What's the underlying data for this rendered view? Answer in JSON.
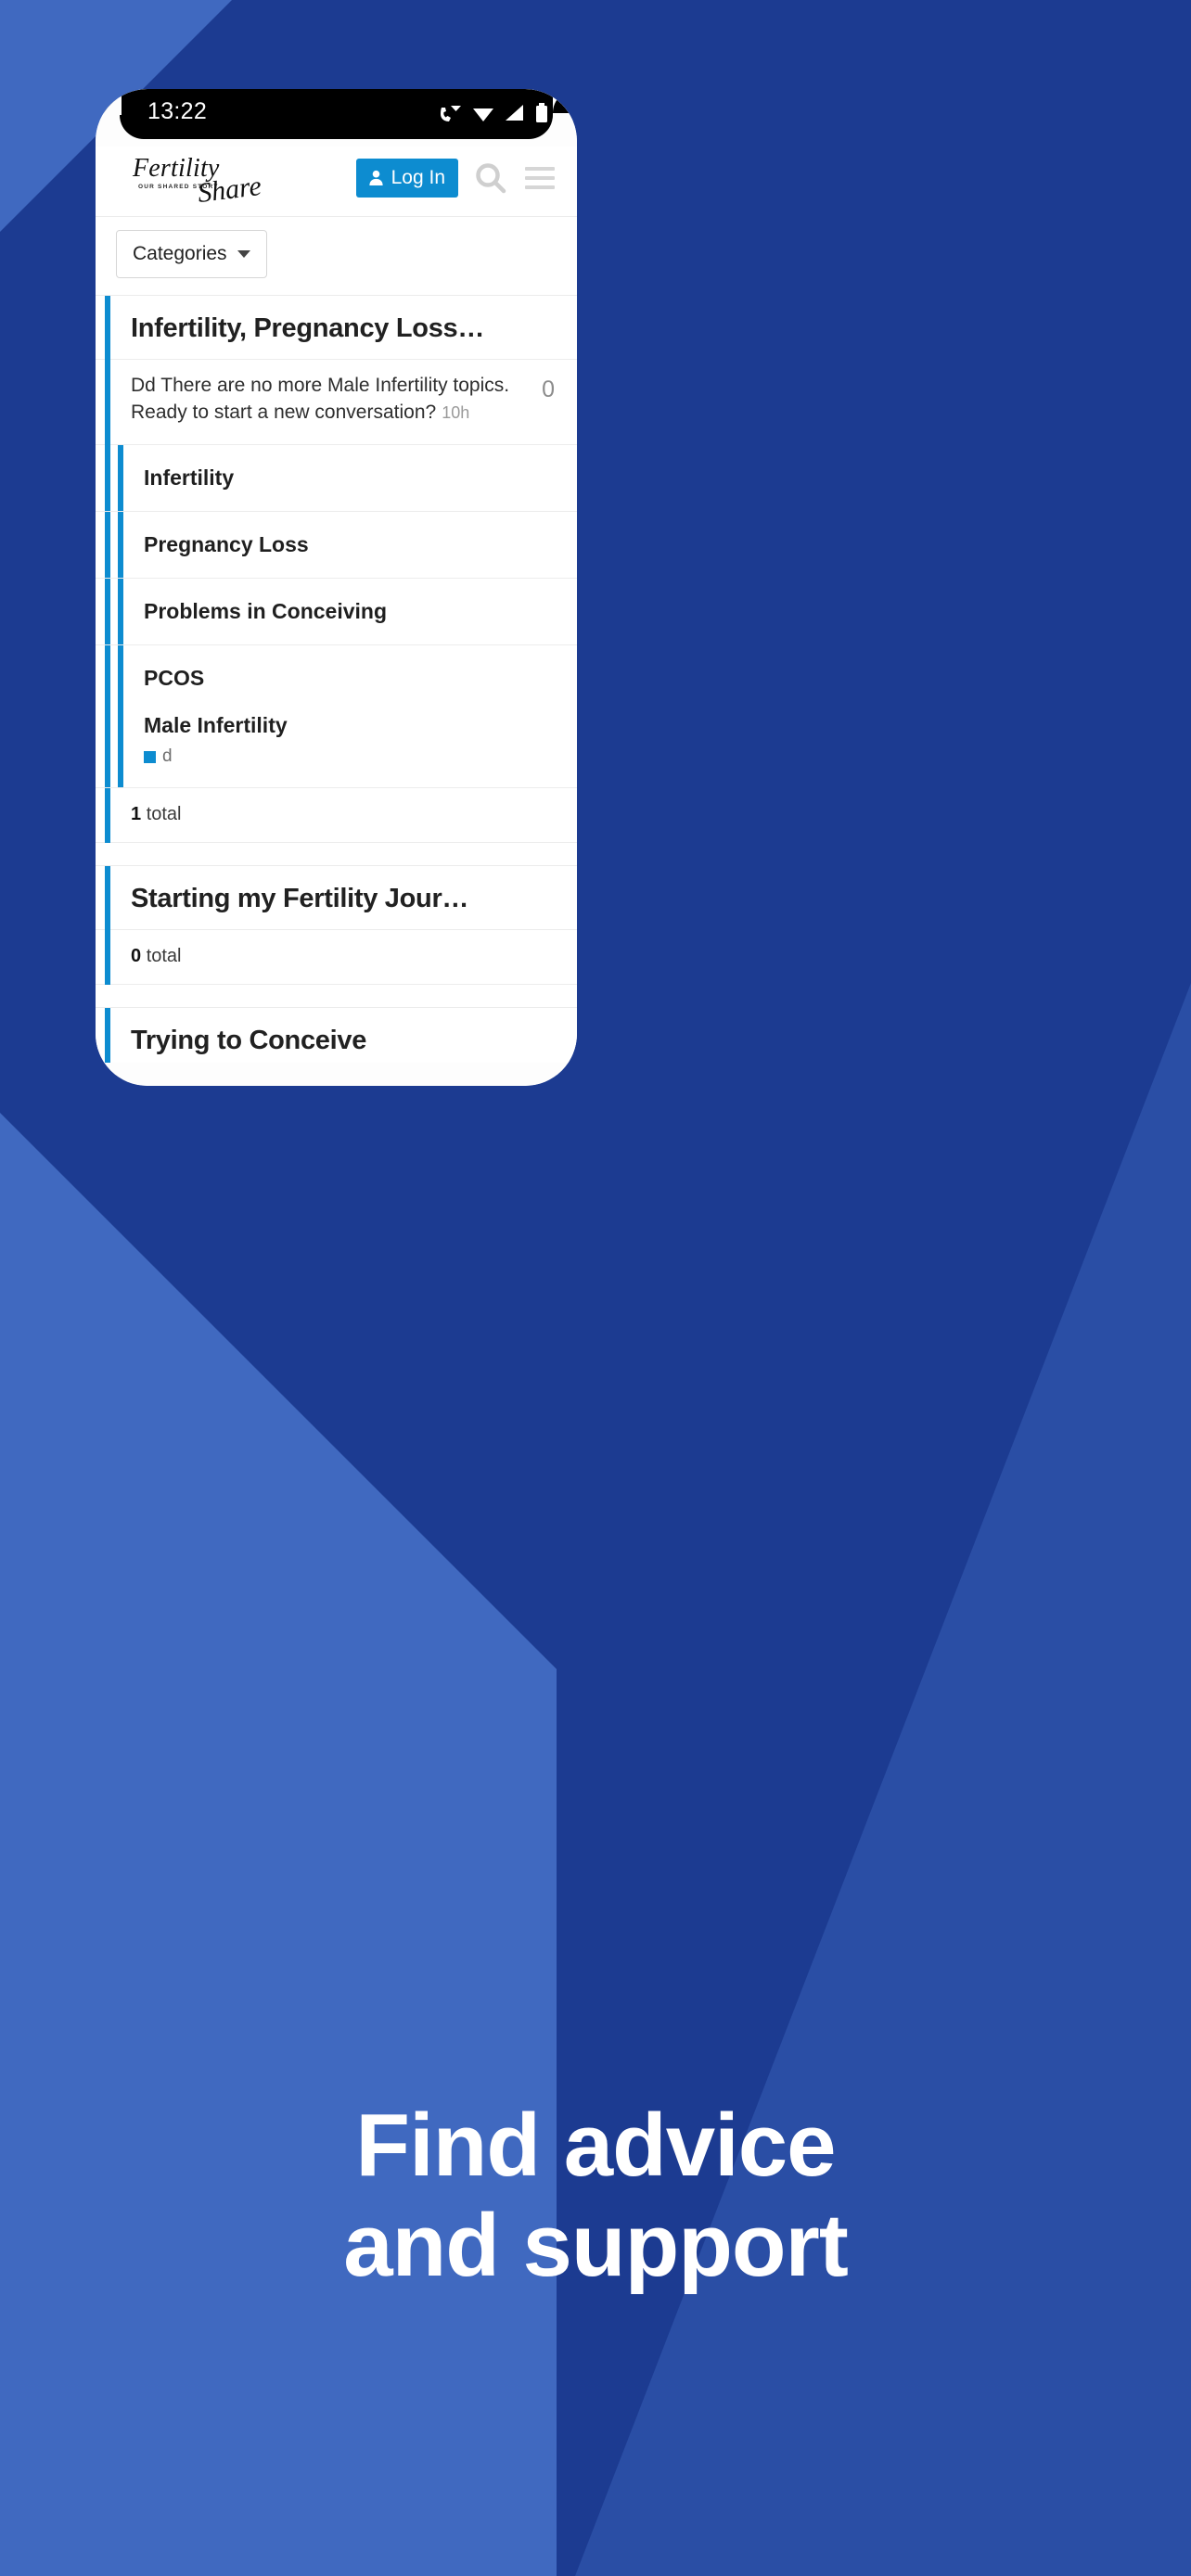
{
  "background": {
    "base_color": "#1c3b91",
    "wedge_color": "#4069c0"
  },
  "phone": {
    "status_bar": {
      "time": "13:22",
      "icons": [
        "call-icon",
        "wifi-icon",
        "signal-icon",
        "battery-icon"
      ]
    },
    "header": {
      "logo_primary": "Fertility",
      "logo_secondary": "Share",
      "logo_tagline": "OUR SHARED STORY",
      "login_label": "Log In",
      "login_icon": "person-icon",
      "search_icon": "search-icon",
      "menu_icon": "hamburger-icon",
      "accent_color": "#0d8cd0"
    },
    "categories": {
      "label": "Categories",
      "caret_icon": "chevron-down-icon"
    },
    "feed": [
      {
        "title": "Infertility, Pregnancy Loss…",
        "post": {
          "text": "Dd There are no more Male Infertility topics. Ready to start a new conversation?",
          "time": "10h",
          "count": "0"
        },
        "subcategories": [
          {
            "name": "Infertility",
            "meta": ""
          },
          {
            "name": "Pregnancy Loss",
            "meta": ""
          },
          {
            "name": "Problems in Conceiving",
            "meta": ""
          },
          {
            "name": "PCOS",
            "meta": ""
          },
          {
            "name": "Male Infertility",
            "meta": "d"
          }
        ],
        "total_count": "1",
        "total_label": "total"
      },
      {
        "title": "Starting my Fertility Jour…",
        "total_count": "0",
        "total_label": "total"
      },
      {
        "title": "Trying to Conceive"
      }
    ]
  },
  "promo": {
    "line1": "Find advice",
    "line2": "and support"
  }
}
